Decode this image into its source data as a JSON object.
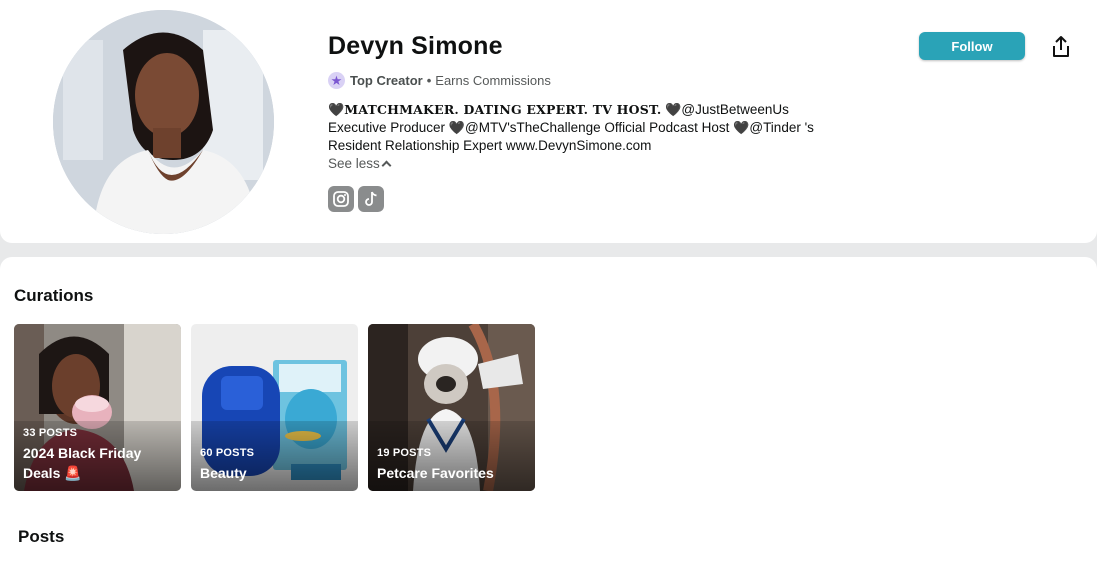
{
  "profile": {
    "name": "Devyn Simone",
    "badge": "Top Creator",
    "separator": "•",
    "earns": "Earns Commissions",
    "bio": {
      "heart": "🖤",
      "headline": "MATCHMAKER. DATING EXPERT. TV HOST.",
      "part1": "@JustBetweenUs Executive Producer",
      "part2": "@MTV'sTheChallenge Official Podcast Host",
      "part3": "@Tinder 's Resident Relationship Expert www.DevynSimone.com"
    },
    "see_less": "See less",
    "follow_label": "Follow",
    "accent_color": "#2aa3b7"
  },
  "social": {
    "instagram_icon": "instagram-icon",
    "tiktok_icon": "tiktok-icon"
  },
  "curations": {
    "title": "Curations",
    "items": [
      {
        "count": "33 POSTS",
        "name_line1": "2024 Black Friday",
        "name_line2": "Deals 🚨"
      },
      {
        "count": "60 POSTS",
        "name_line1": "Beauty"
      },
      {
        "count": "19 POSTS",
        "name_line1": "Petcare Favorites"
      }
    ]
  },
  "posts": {
    "title": "Posts"
  }
}
